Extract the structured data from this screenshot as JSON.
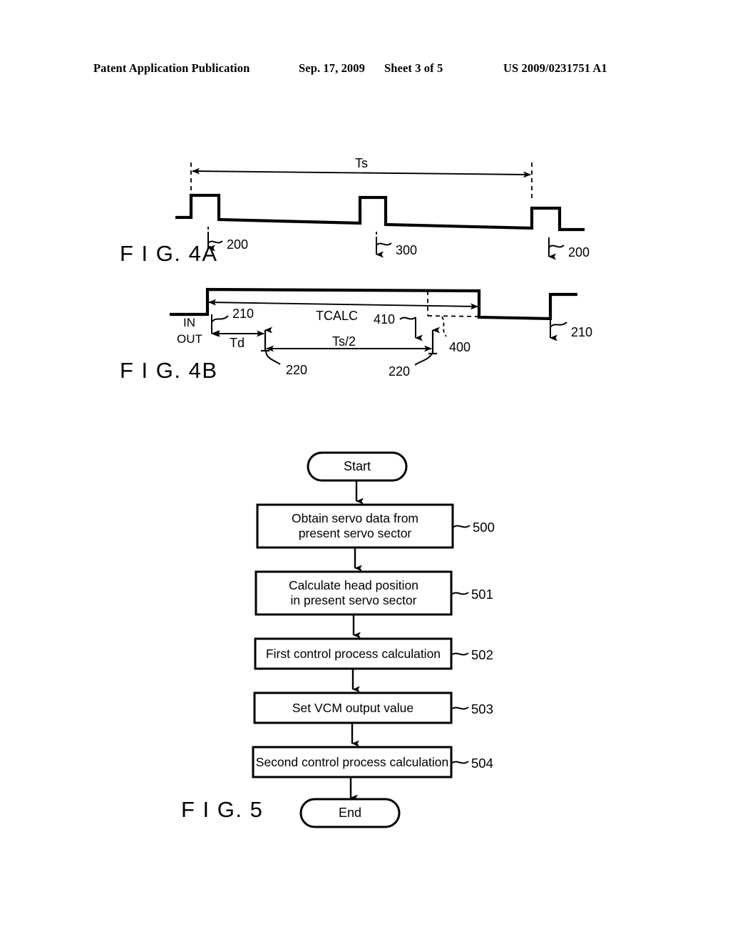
{
  "header": {
    "publication": "Patent Application Publication",
    "date": "Sep. 17, 2009",
    "sheet": "Sheet 3 of 5",
    "patent_number": "US 2009/0231751 A1"
  },
  "figures": {
    "fig4a": {
      "label": "F I G. 4A",
      "dimension_label": "Ts",
      "callouts": [
        {
          "id": "fig4a-callout-200-left",
          "text": "200"
        },
        {
          "id": "fig4a-callout-300",
          "text": "300"
        },
        {
          "id": "fig4a-callout-200-right",
          "text": "200"
        }
      ]
    },
    "fig4b": {
      "label": "F I G. 4B",
      "signal_in": "IN",
      "signal_out": "OUT",
      "td_label": "Td",
      "tcalc_label": "TCALC",
      "ts_half_label": "Ts/2",
      "callouts": [
        {
          "id": "fig4b-callout-210-left",
          "text": "210"
        },
        {
          "id": "fig4b-callout-210-right",
          "text": "210"
        },
        {
          "id": "fig4b-callout-220-left",
          "text": "220"
        },
        {
          "id": "fig4b-callout-220-right",
          "text": "220"
        },
        {
          "id": "fig4b-callout-400",
          "text": "400"
        },
        {
          "id": "fig4b-callout-410",
          "text": "410"
        }
      ]
    },
    "fig5": {
      "label": "F I G. 5",
      "start_label": "Start",
      "end_label": "End",
      "steps": [
        {
          "text": "Obtain servo data from\npresent servo sector",
          "ref": "500"
        },
        {
          "text": "Calculate head position\nin present servo sector",
          "ref": "501"
        },
        {
          "text": "First control process calculation",
          "ref": "502"
        },
        {
          "text": "Set VCM output value",
          "ref": "503"
        },
        {
          "text": "Second control process calculation",
          "ref": "504"
        }
      ]
    }
  },
  "colors": {
    "ink": "#000000",
    "paper": "#ffffff"
  }
}
